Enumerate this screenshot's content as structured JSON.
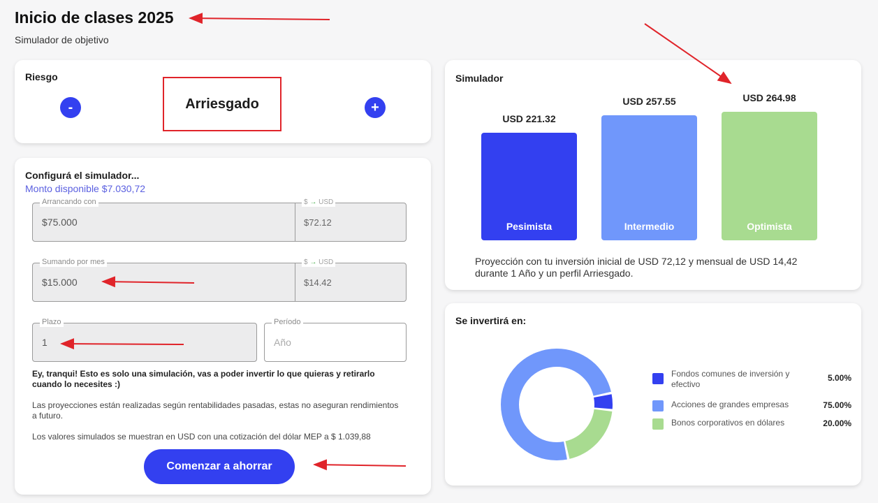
{
  "header": {
    "title": "Inicio de clases 2025",
    "subtitle": "Simulador de objetivo"
  },
  "risk": {
    "title": "Riesgo",
    "minus_label": "-",
    "plus_label": "+",
    "value": "Arriesgado"
  },
  "config": {
    "title": "Configurá el simulador...",
    "available": "Monto disponible $7.030,72",
    "start": {
      "label": "Arrancando con",
      "value": "$75.000",
      "usd_label_from": "$",
      "usd_label_to": "USD",
      "usd_value": "$72.12"
    },
    "monthly": {
      "label": "Sumando por mes",
      "value": "$15.000",
      "usd_label_from": "$",
      "usd_label_to": "USD",
      "usd_value": "$14.42"
    },
    "term": {
      "label": "Plazo",
      "value": "1"
    },
    "period": {
      "label": "Período",
      "placeholder": "Año"
    },
    "note_bold": "Ey, tranqui! Esto es solo una simulación, vas a poder invertir lo que quieras y retirarlo cuando lo necesites :)",
    "note_1": "Las proyecciones están realizadas según rentabilidades pasadas, estas no aseguran rendimientos a futuro.",
    "note_2": "Los valores simulados se muestran en USD con una cotización del dólar MEP a $ 1.039,88",
    "cta_label": "Comenzar a ahorrar"
  },
  "simulator": {
    "title": "Simulador",
    "projection": "Proyección con tu inversión inicial de USD 72,12 y mensual de USD 14,42 durante 1 Año y un perfil Arriesgado."
  },
  "chart_data": [
    {
      "type": "bar",
      "categories": [
        "Pesimista",
        "Intermedio",
        "Optimista"
      ],
      "values": [
        221.32,
        257.55,
        264.98
      ],
      "value_labels": [
        "USD 221.32",
        "USD 257.55",
        "USD 264.98"
      ],
      "colors": [
        "#3340f0",
        "#7097fb",
        "#a8db90"
      ]
    },
    {
      "type": "pie",
      "title": "Se invertirá en:",
      "labels": [
        "Fondos comunes de inversión y efectivo",
        "Acciones de grandes empresas",
        "Bonos corporativos en dólares"
      ],
      "values": [
        5,
        75,
        20
      ],
      "value_labels": [
        "5.00%",
        "75.00%",
        "20.00%"
      ],
      "colors": [
        "#3340f0",
        "#7097fb",
        "#a8db90"
      ]
    }
  ],
  "colors": {
    "accent": "#3340f0",
    "link": "#5a5fe0",
    "highlight": "#e0242a"
  },
  "icons": {
    "arrow": "arrow-right-icon"
  }
}
